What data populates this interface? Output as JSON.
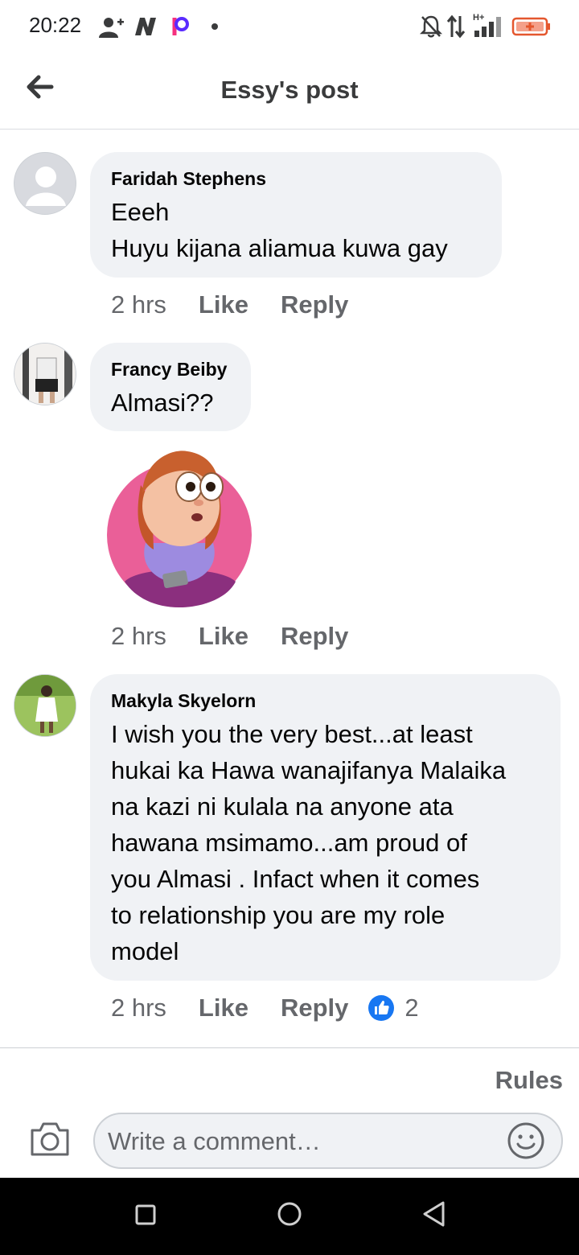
{
  "status_bar": {
    "time": "20:22",
    "left_icons": [
      "person-add-icon",
      "n-app-icon",
      "p-app-icon",
      "dot-icon"
    ],
    "right_icons": [
      "mute-icon",
      "data-transfer-icon",
      "signal-icon",
      "battery-icon"
    ],
    "network": "H+"
  },
  "header": {
    "title": "Essy's post",
    "back_icon": "back-arrow-icon"
  },
  "comments": [
    {
      "author": "Faridah Stephens",
      "text": "Eeeh\nHuyu kijana aliamua kuwa gay",
      "time": "2 hrs",
      "like_label": "Like",
      "reply_label": "Reply"
    },
    {
      "author": "Francy Beiby",
      "text": "Almasi??",
      "sticker": "cartoon-girl-sticker",
      "time": "2 hrs",
      "like_label": "Like",
      "reply_label": "Reply"
    },
    {
      "author": "Makyla Skyelorn",
      "text": "I wish you the very best...at least\nhukai ka Hawa wanajifanya Malaika\nna kazi ni kulala na anyone ata\nhawana msimamo...am proud of\nyou Almasi . Infact when it comes\nto relationship you are my role\nmodel",
      "time": "2 hrs",
      "like_label": "Like",
      "reply_label": "Reply",
      "reaction_icon": "like-reaction-icon",
      "reaction_count": "2"
    }
  ],
  "footer": {
    "rules_label": "Rules",
    "comment_placeholder": "Write a comment…",
    "camera_icon": "camera-icon",
    "emoji_icon": "emoji-icon"
  },
  "colors": {
    "bubble_bg": "#f0f2f5",
    "secondary_text": "#65676b",
    "like_blue": "#1877f2",
    "battery_red": "#e4572e",
    "p_icon": "#f5317f"
  }
}
